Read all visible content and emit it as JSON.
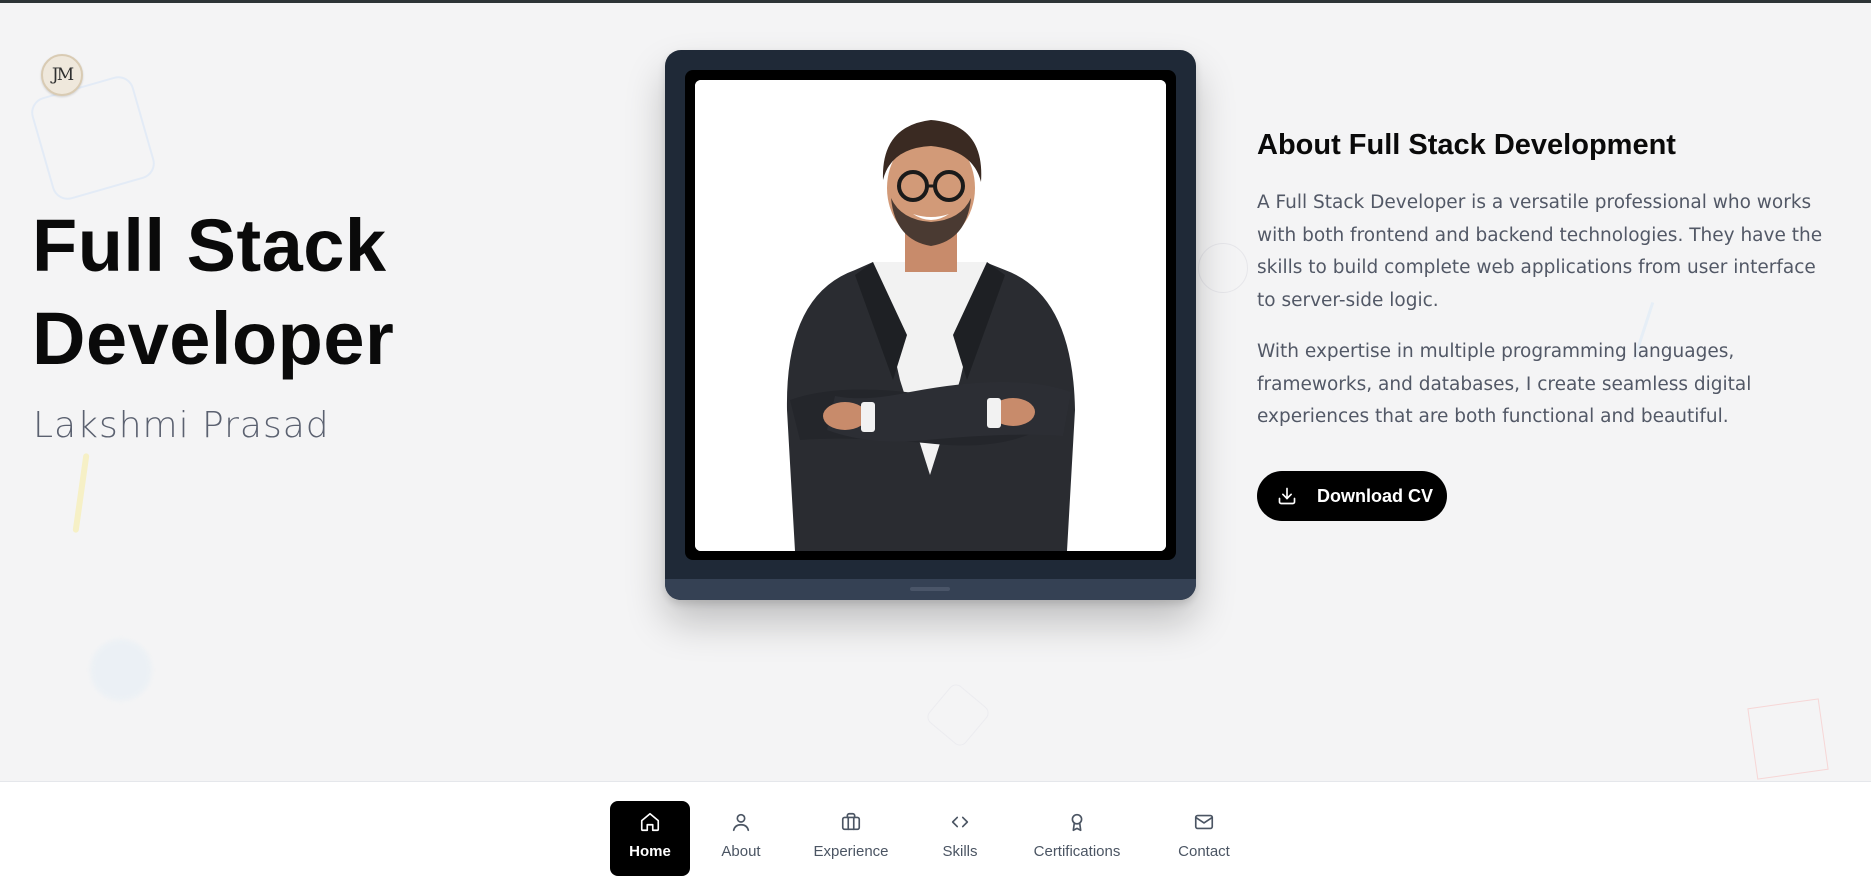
{
  "colors": {
    "background": "#f4f4f5",
    "accent": "#000000",
    "text_primary": "#0a0a0a",
    "text_secondary": "#525866",
    "device_frame": "#1f2937"
  },
  "brand": {
    "logo_text": "JM"
  },
  "hero": {
    "title": "Full Stack Developer",
    "subtitle": "Lakshmi Prasad",
    "photo_icon": "portrait-photo"
  },
  "about": {
    "heading": "About Full Stack Development",
    "paragraph_1": "A Full Stack Developer is a versatile professional who works with both frontend and backend technologies. They have the skills to build complete web applications from user interface to server-side logic.",
    "paragraph_2": "With expertise in multiple programming languages, frameworks, and databases, I create seamless digital experiences that are both functional and beautiful.",
    "cv_button_label": "Download CV",
    "cv_button_icon": "download-icon"
  },
  "nav": {
    "active": "Home",
    "items": [
      {
        "label": "Home",
        "icon": "home-icon"
      },
      {
        "label": "About",
        "icon": "user-icon"
      },
      {
        "label": "Experience",
        "icon": "briefcase-icon"
      },
      {
        "label": "Skills",
        "icon": "code-icon"
      },
      {
        "label": "Certifications",
        "icon": "award-icon"
      },
      {
        "label": "Contact",
        "icon": "mail-icon"
      }
    ]
  }
}
